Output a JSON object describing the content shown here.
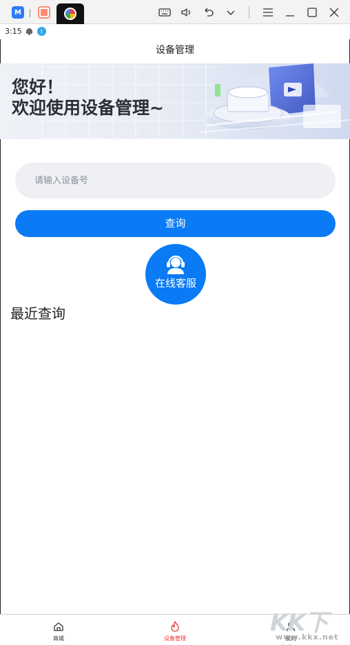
{
  "titlebar": {
    "icons": [
      "meitu-app-icon",
      "orange-app-icon",
      "active-app-icon",
      "keyboard-icon",
      "volume-icon",
      "undo-icon",
      "chevron-down-icon",
      "menu-icon",
      "minimize-icon",
      "maximize-icon",
      "close-icon"
    ]
  },
  "status": {
    "time": "3:15",
    "bluetooth": "ᛒ"
  },
  "header": {
    "title": "设备管理"
  },
  "banner": {
    "line1": "您好！",
    "line2": "欢迎使用设备管理~"
  },
  "search": {
    "placeholder": "请输入设备号",
    "value": "",
    "button_label": "查询"
  },
  "support": {
    "label": "在线客服"
  },
  "recent": {
    "title": "最近查询"
  },
  "bottom_nav": {
    "items": [
      {
        "label": "商城",
        "icon": "home-icon"
      },
      {
        "label": "设备管理",
        "icon": "flame-icon",
        "active": true
      },
      {
        "label": "我的",
        "icon": "user-icon"
      }
    ]
  },
  "watermark": {
    "logo": "KK下载",
    "url": "www.kkx.net"
  },
  "colors": {
    "primary": "#0a7af5",
    "active_tab": "#e53935",
    "input_bg": "#eef0f4"
  }
}
